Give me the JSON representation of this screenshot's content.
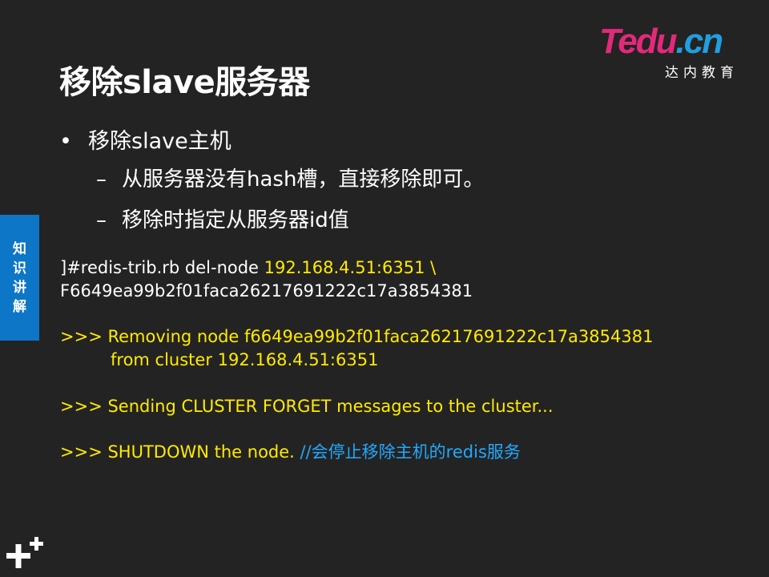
{
  "title": "移除slave服务器",
  "logo": {
    "mark_t": "T",
    "mark_edu": "edu",
    "mark_dot": ".",
    "mark_cn": "cn",
    "subtitle": "达内教育"
  },
  "side_tab": [
    "知",
    "识",
    "讲",
    "解"
  ],
  "bullet": {
    "symbol": "•",
    "text": "移除slave主机"
  },
  "sub_items": [
    {
      "dash": "–",
      "text": "从服务器没有hash槽，直接移除即可。"
    },
    {
      "dash": "–",
      "text": "移除时指定从服务器id值"
    }
  ],
  "code": {
    "line1_cmd": "]#redis-trib.rb   del-node ",
    "line1_addr": "192.168.4.51:6351  \\",
    "line2": "F6649ea99b2f01faca26217691222c17a3854381",
    "line3": ">>> Removing node f6649ea99b2f01faca26217691222c17a3854381",
    "line4": "from cluster 192.168.4.51:6351",
    "line5": ">>> Sending CLUSTER FORGET messages to the cluster...",
    "line6": ">>> SHUTDOWN the node.  ",
    "line6_comment": "//会停止移除主机的redis服务"
  },
  "colors": {
    "background": "#242323",
    "code_yellow": "#ffeb00",
    "comment_blue": "#21a9ff",
    "tab_blue": "#0e76c7",
    "logo_pink": "#e3297b"
  },
  "icons": {
    "corner": "plus-icon"
  }
}
